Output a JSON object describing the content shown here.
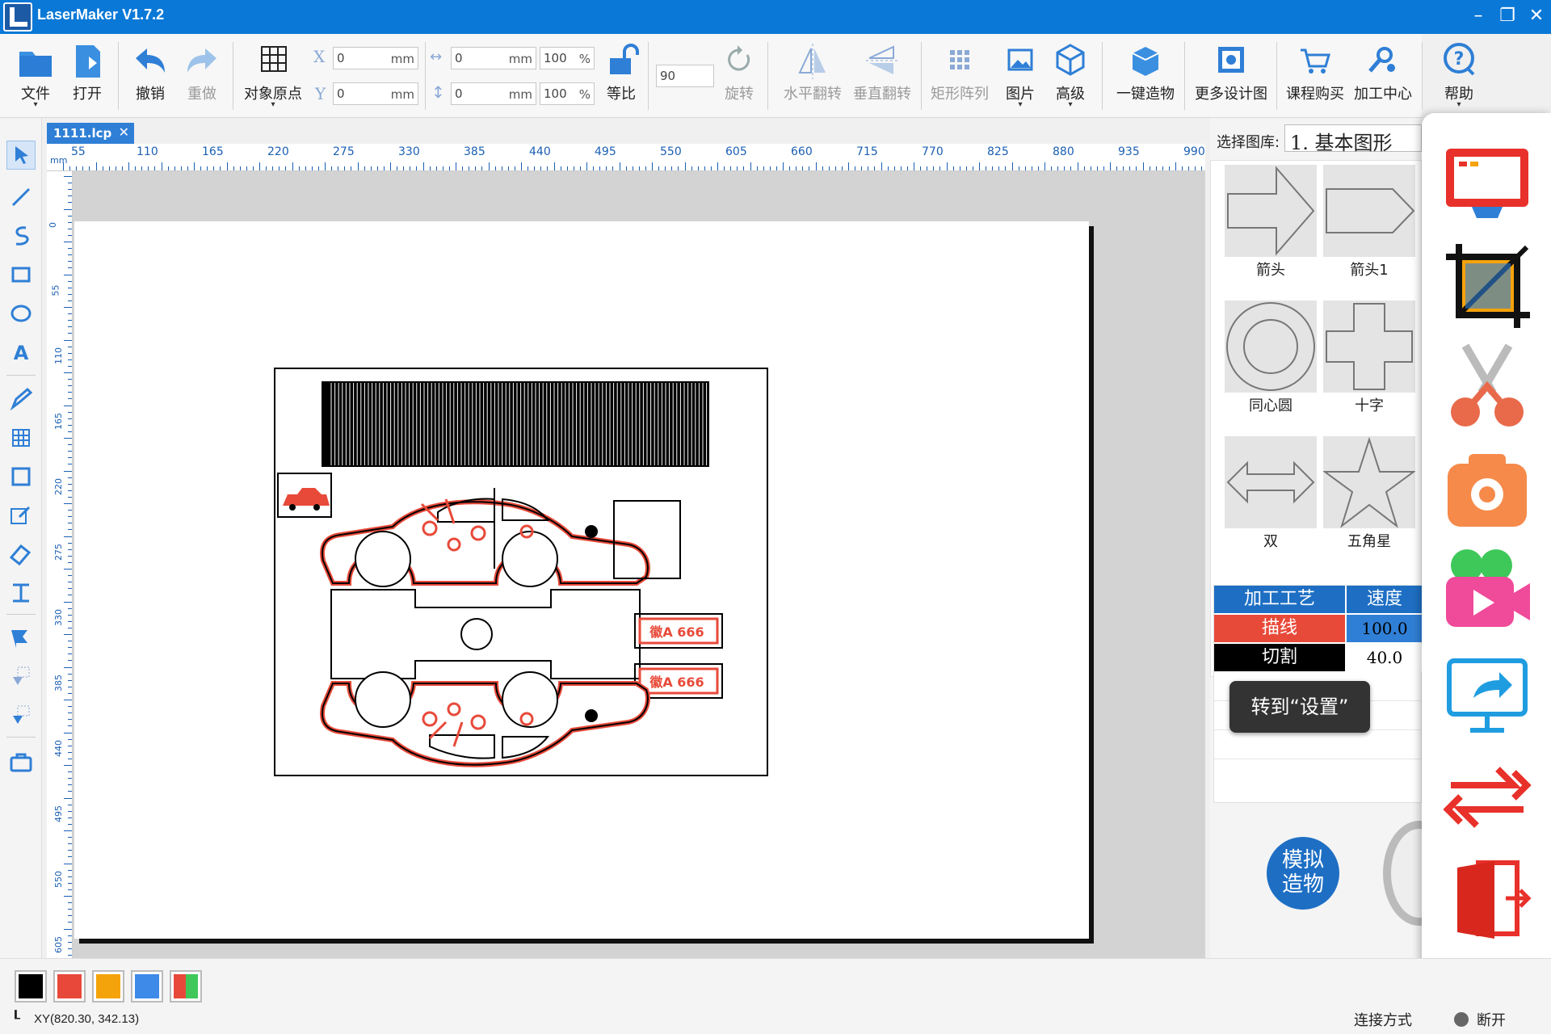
{
  "app": {
    "title": "LaserMaker V1.7.2"
  },
  "window": {
    "minimize": "–",
    "restore": "❐",
    "close": "✕"
  },
  "toolbar": {
    "file": "文件",
    "open": "打开",
    "undo": "撤销",
    "redo": "重做",
    "origin": "对象原点",
    "proportional": "等比",
    "rotate": "旋转",
    "hflip": "水平翻转",
    "vflip": "垂直翻转",
    "array": "矩形阵列",
    "image": "图片",
    "advanced": "高级",
    "onekey": "一键造物",
    "more_designs": "更多设计图",
    "course": "课程购买",
    "processing": "加工中心",
    "help": "帮助",
    "x_label": "X",
    "y_label": "Y",
    "x_value": "0",
    "y_value": "0",
    "unit": "mm",
    "width_value": "0",
    "height_value": "0",
    "width_pct": "100",
    "height_pct": "100",
    "pct": "%",
    "rotate_angle": "90"
  },
  "document": {
    "tab": "1111.lcp",
    "tab_close": "✕"
  },
  "ruler": {
    "unit": "mm",
    "h_ticks": [
      "55",
      "110",
      "165",
      "220",
      "275",
      "330",
      "385",
      "440",
      "495",
      "550",
      "605",
      "660",
      "715",
      "770",
      "825",
      "880",
      "935",
      "990"
    ],
    "v_ticks": [
      "0",
      "55",
      "110",
      "165",
      "220",
      "275",
      "330",
      "385",
      "440",
      "495",
      "550",
      "605"
    ]
  },
  "library": {
    "label": "选择图库:",
    "selected": "1. 基本图形",
    "shapes": [
      {
        "name": "箭头"
      },
      {
        "name": "箭头1"
      },
      {
        "name": "同心圆"
      },
      {
        "name": "十字"
      },
      {
        "name": "双"
      },
      {
        "name": "五角星"
      }
    ]
  },
  "process": {
    "header_process": "加工工艺",
    "header_speed": "速度",
    "rows": [
      {
        "name": "描线",
        "speed": "100.0",
        "color": "#e84a3a"
      },
      {
        "name": "切割",
        "speed": "40.0",
        "color": "#000000"
      }
    ]
  },
  "tooltip": "转到“设置”",
  "simulate": "模拟造物",
  "status": {
    "coords": "XY(820.30, 342.13)",
    "connection_label": "连接方式",
    "connection_state": "断开"
  },
  "colors": {
    "swatches": [
      "#000000",
      "#e8483a",
      "#f5a30a",
      "#3d8ae8",
      "multi"
    ],
    "accent": "#0a78d7",
    "engrave": "#e84a3a"
  },
  "canvas": {
    "plate_text": "徽A 666"
  }
}
